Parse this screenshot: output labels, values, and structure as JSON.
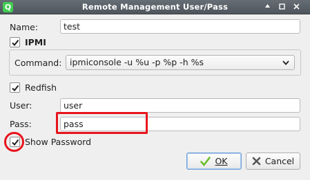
{
  "window": {
    "title": "Remote Management User/Pass",
    "app_icon": "Q",
    "buttons": [
      "up-arrow-icon",
      "maximize-icon",
      "close-icon"
    ]
  },
  "form": {
    "name_label": "Name:",
    "name_value": "test",
    "ipmi_label": "IPMI",
    "ipmi_checked": true,
    "command_label": "Command:",
    "command_value": "ipmiconsole -u %u -p %p -h %s",
    "redfish_label": "Redfish",
    "redfish_checked": true,
    "user_label": "User:",
    "user_value": "user",
    "pass_label": "Pass:",
    "pass_value": "pass",
    "show_password_label": "Show Password",
    "show_password_checked": true
  },
  "buttons": {
    "ok_label": "OK",
    "cancel_label": "Cancel"
  },
  "colors": {
    "highlight": "#e8131b",
    "titlebar": "#5a6168",
    "ok_icon": "#6abf2a",
    "cancel_icon": "#555555"
  }
}
